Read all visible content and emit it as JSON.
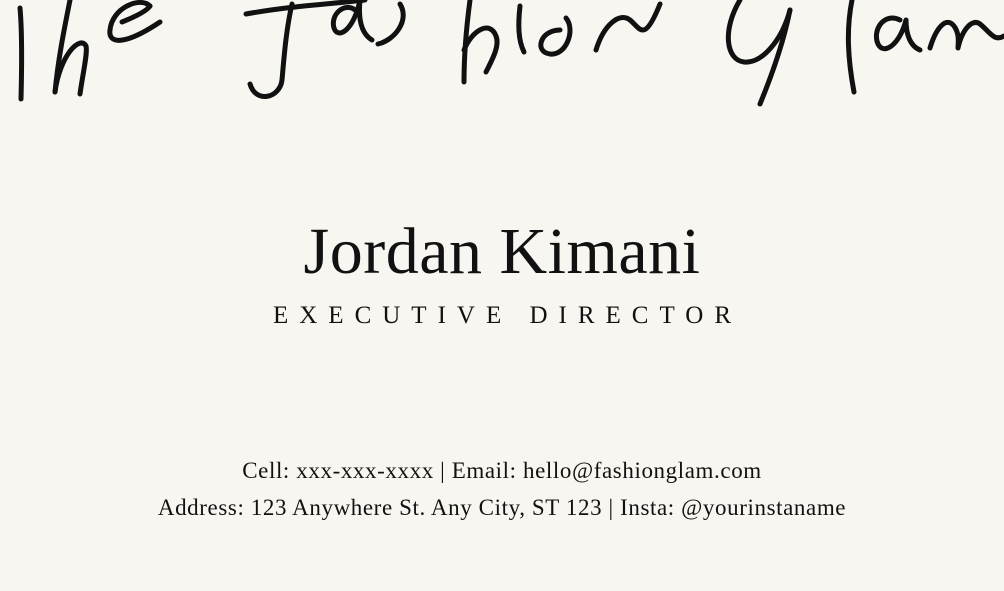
{
  "brand": {
    "script_text": "The Fashion Glam"
  },
  "person": {
    "name": "Jordan Kimani",
    "title": "EXECUTIVE DIRECTOR"
  },
  "contact": {
    "line1": "Cell: xxx-xxx-xxxx | Email: hello@fashionglam.com",
    "line2": "Address: 123 Anywhere St. Any City, ST 123 | Insta: @yourinstaname"
  },
  "colors": {
    "background": "#f8f6f1",
    "ink": "#111111"
  }
}
